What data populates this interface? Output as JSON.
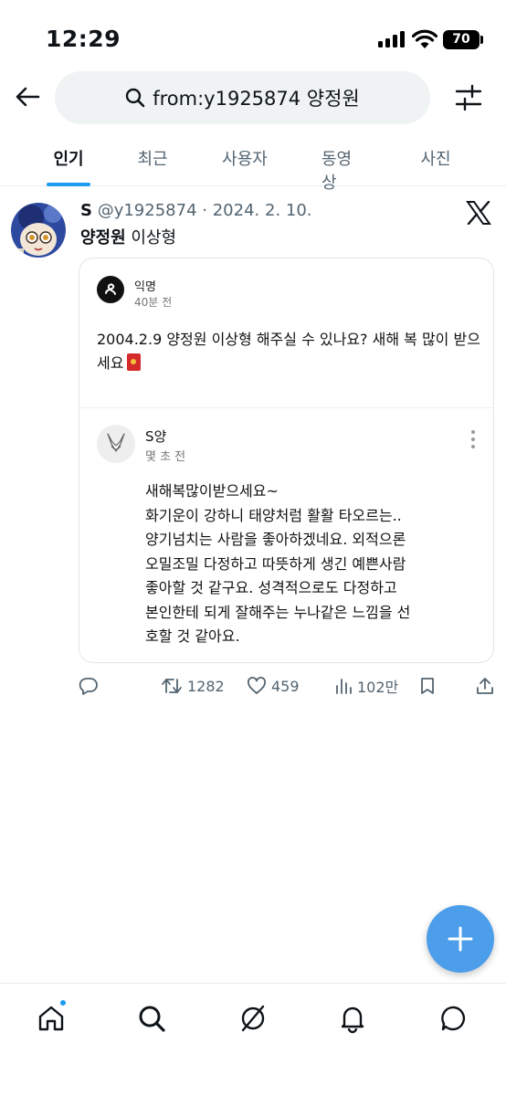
{
  "status_bar": {
    "time": "12:29",
    "battery": "70"
  },
  "search": {
    "query": "from:y1925874 양정원"
  },
  "tabs": [
    {
      "label": "인기",
      "active": true
    },
    {
      "label": "최근",
      "active": false
    },
    {
      "label": "사용자",
      "active": false
    },
    {
      "label": "동영상",
      "active": false
    },
    {
      "label": "사진",
      "active": false
    }
  ],
  "tweet": {
    "display_name": "S",
    "handle": "@y1925874",
    "date": "2024. 2. 10.",
    "text_bold": "양정원",
    "text_rest": " 이상형",
    "card": {
      "question_author": "익명",
      "question_time": "40분 전",
      "question_text": "2004.2.9 양정원 이상형 해주실 수 있나요? 새해 복 많이 받으세요",
      "answer_author": "S양",
      "answer_time": "몇 초 전",
      "answer_lines": [
        "새해복많이받으세요~",
        "화기운이 강하니 태양처럼 활활 타오르는..",
        "양기넘치는 사람을 좋아하겠네요. 외적으론",
        "오밀조밀 다정하고 따뜻하게 생긴 예쁜사람",
        "좋아할 것 같구요. 성격적으로도 다정하고",
        "본인한테 되게 잘해주는 누나같은 느낌을 선",
        "호할 것 같아요."
      ]
    },
    "stats": {
      "retweets": "1282",
      "likes": "459",
      "views": "102만"
    }
  },
  "colors": {
    "accent": "#1d9bf0",
    "fab": "#4c9eea",
    "muted": "#536471"
  }
}
